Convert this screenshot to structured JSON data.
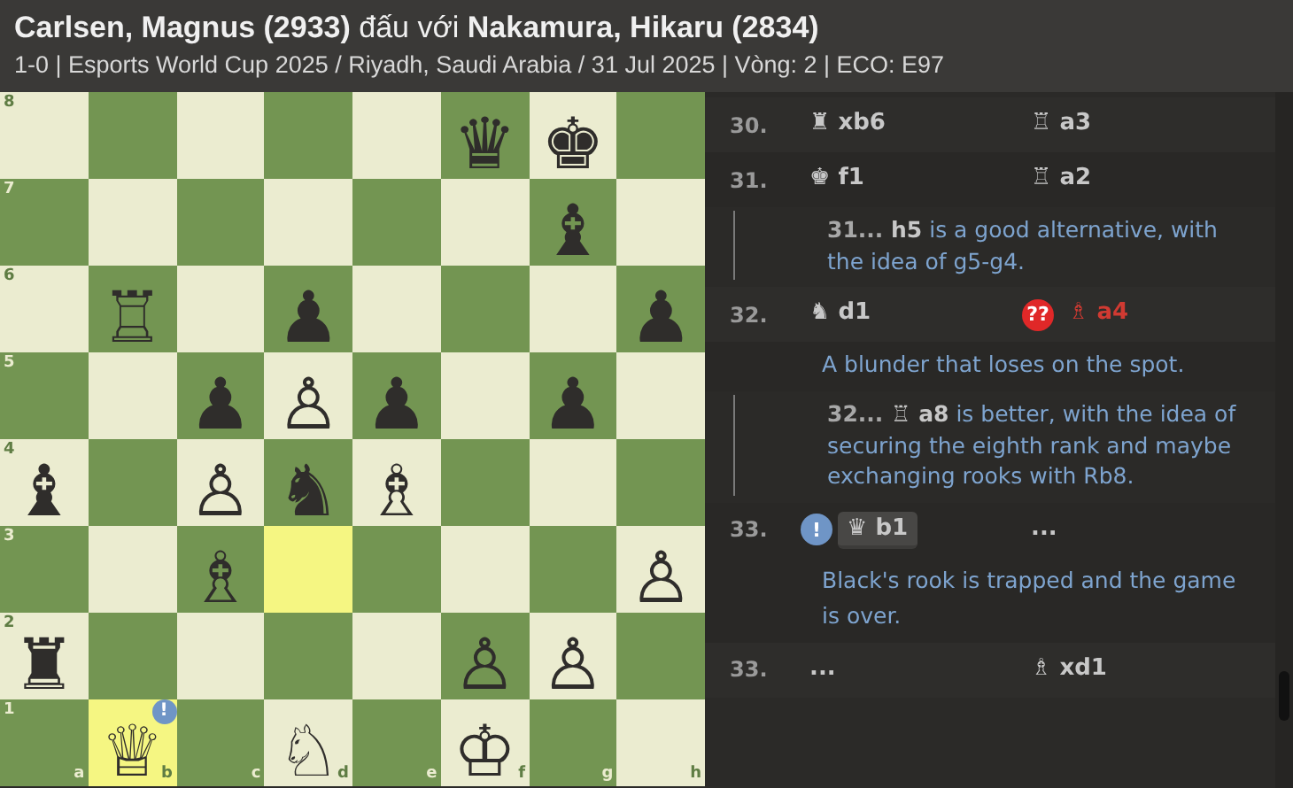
{
  "header": {
    "white_player": "Carlsen, Magnus (2933)",
    "versus": "đấu với",
    "black_player": "Nakamura, Hikaru (2834)",
    "info": "1-0 | Esports World Cup 2025 / Riyadh, Saudi Arabia / 31 Jul 2025 | Vòng: 2 | ECO: E97"
  },
  "board": {
    "files": [
      "a",
      "b",
      "c",
      "d",
      "e",
      "f",
      "g",
      "h"
    ],
    "ranks": [
      {
        "label": "8",
        "squares": [
          {
            "highlighted": false
          },
          {
            "highlighted": false
          },
          {
            "highlighted": false
          },
          {
            "highlighted": false
          },
          {
            "highlighted": false
          },
          {
            "piece": "♛",
            "highlighted": false
          },
          {
            "piece": "♚",
            "highlighted": false
          },
          {
            "highlighted": false
          }
        ]
      },
      {
        "label": "7",
        "squares": [
          {
            "highlighted": false
          },
          {
            "highlighted": false
          },
          {
            "highlighted": false
          },
          {
            "highlighted": false
          },
          {
            "highlighted": false
          },
          {
            "highlighted": false
          },
          {
            "piece": "♝",
            "highlighted": false
          },
          {
            "highlighted": false
          }
        ]
      },
      {
        "label": "6",
        "squares": [
          {
            "highlighted": false
          },
          {
            "piece": "♖",
            "highlighted": false
          },
          {
            "highlighted": false
          },
          {
            "piece": "♟",
            "highlighted": false
          },
          {
            "highlighted": false
          },
          {
            "highlighted": false
          },
          {
            "highlighted": false
          },
          {
            "piece": "♟",
            "highlighted": false
          }
        ]
      },
      {
        "label": "5",
        "squares": [
          {
            "highlighted": false
          },
          {
            "highlighted": false
          },
          {
            "piece": "♟",
            "highlighted": false
          },
          {
            "piece": "♙",
            "highlighted": false
          },
          {
            "piece": "♟",
            "highlighted": false
          },
          {
            "highlighted": false
          },
          {
            "piece": "♟",
            "highlighted": false
          },
          {
            "highlighted": false
          }
        ]
      },
      {
        "label": "4",
        "squares": [
          {
            "piece": "♝",
            "highlighted": false
          },
          {
            "highlighted": false
          },
          {
            "piece": "♙",
            "highlighted": false
          },
          {
            "piece": "♞",
            "highlighted": false
          },
          {
            "piece": "♗",
            "highlighted": false
          },
          {
            "highlighted": false
          },
          {
            "highlighted": false
          },
          {
            "highlighted": false
          }
        ]
      },
      {
        "label": "3",
        "squares": [
          {
            "highlighted": false
          },
          {
            "highlighted": false
          },
          {
            "piece": "♗",
            "highlighted": false
          },
          {
            "highlighted": true
          },
          {
            "highlighted": false
          },
          {
            "highlighted": false
          },
          {
            "highlighted": false
          },
          {
            "piece": "♙",
            "highlighted": false
          }
        ]
      },
      {
        "label": "2",
        "squares": [
          {
            "piece": "♜",
            "highlighted": false
          },
          {
            "highlighted": false
          },
          {
            "highlighted": false
          },
          {
            "highlighted": false
          },
          {
            "highlighted": false
          },
          {
            "piece": "♙",
            "highlighted": false
          },
          {
            "piece": "♙",
            "highlighted": false
          },
          {
            "highlighted": false
          }
        ]
      },
      {
        "label": "1",
        "squares": [
          {
            "highlighted": false
          },
          {
            "piece": "♕",
            "highlighted": true,
            "annotation": {
              "text": "!",
              "kind": "good"
            }
          },
          {
            "highlighted": false
          },
          {
            "piece": "♘",
            "highlighted": false
          },
          {
            "highlighted": false
          },
          {
            "piece": "♔",
            "highlighted": false
          },
          {
            "highlighted": false
          },
          {
            "highlighted": false
          }
        ]
      }
    ]
  },
  "moves": [
    {
      "kind": "move",
      "number": "30.",
      "white": {
        "piece": "♜",
        "san": "xb6",
        "selected": false
      },
      "black": {
        "piece": "♖",
        "san": "a3",
        "selected": false
      }
    },
    {
      "kind": "move",
      "number": "31.",
      "white": {
        "piece": "♚",
        "san": "f1",
        "selected": false
      },
      "black": {
        "piece": "♖",
        "san": "a2",
        "selected": false
      }
    },
    {
      "kind": "variation",
      "prefix": "31...",
      "san": "h5",
      "text": "is a good alternative, with the idea of g5-g4."
    },
    {
      "kind": "move",
      "number": "32.",
      "white": {
        "piece": "♞",
        "san": "d1",
        "selected": false
      },
      "black": {
        "piece": "♗",
        "san": "a4",
        "selected": false,
        "annotation": {
          "text": "??",
          "kind": "blunder"
        }
      }
    },
    {
      "kind": "comment",
      "text": "A blunder that loses on the spot."
    },
    {
      "kind": "variation",
      "prefix": "32...",
      "piece": "♖",
      "san": "a8",
      "text": "is better, with the idea of securing the eighth rank and maybe exchanging rooks with Rb8."
    },
    {
      "kind": "move",
      "number": "33.",
      "white": {
        "piece": "♛",
        "san": "b1",
        "selected": true,
        "annotation": {
          "text": "!",
          "kind": "good"
        }
      },
      "black": {
        "san": "...",
        "selected": false
      }
    },
    {
      "kind": "comment",
      "text": "Black's rook is trapped and the game is over."
    },
    {
      "kind": "move",
      "number": "33.",
      "white": {
        "san": "...",
        "selected": false
      },
      "black": {
        "piece": "♗",
        "san": "xd1",
        "selected": false
      }
    }
  ]
}
